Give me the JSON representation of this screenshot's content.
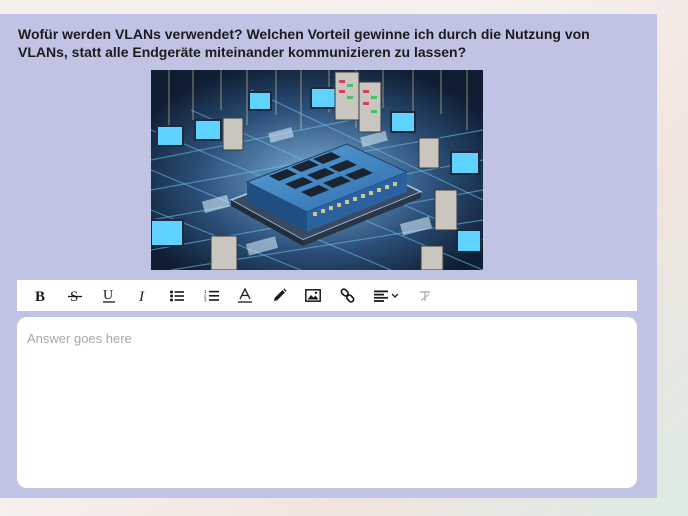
{
  "question": {
    "text": "Wofür werden VLANs verwendet? Welchen Vorteil gewinne ich durch die Nutzung von VLANs, statt alle Endgeräte miteinander kommunizieren zu lassen?"
  },
  "illustration": {
    "subject": "network-switch-illustration"
  },
  "toolbar": {
    "buttons": [
      {
        "name": "bold-button",
        "icon": "bold-icon"
      },
      {
        "name": "strikethrough-button",
        "icon": "strikethrough-icon"
      },
      {
        "name": "underline-button",
        "icon": "underline-icon"
      },
      {
        "name": "italic-button",
        "icon": "italic-icon"
      },
      {
        "name": "bullet-list-button",
        "icon": "bullet-list-icon"
      },
      {
        "name": "numbered-list-button",
        "icon": "numbered-list-icon"
      },
      {
        "name": "text-color-button",
        "icon": "text-color-icon"
      },
      {
        "name": "highlight-button",
        "icon": "pen-icon"
      },
      {
        "name": "insert-image-button",
        "icon": "image-icon"
      },
      {
        "name": "insert-link-button",
        "icon": "link-icon"
      },
      {
        "name": "align-dropdown-button",
        "icon": "align-left-icon"
      },
      {
        "name": "clear-format-button",
        "icon": "clear-format-icon"
      }
    ]
  },
  "answer": {
    "placeholder": "Answer goes here",
    "value": ""
  },
  "colors": {
    "panel_background": "#c0c3e3",
    "toolbar_background": "#ffffff",
    "placeholder_text": "#a8a8a8"
  }
}
